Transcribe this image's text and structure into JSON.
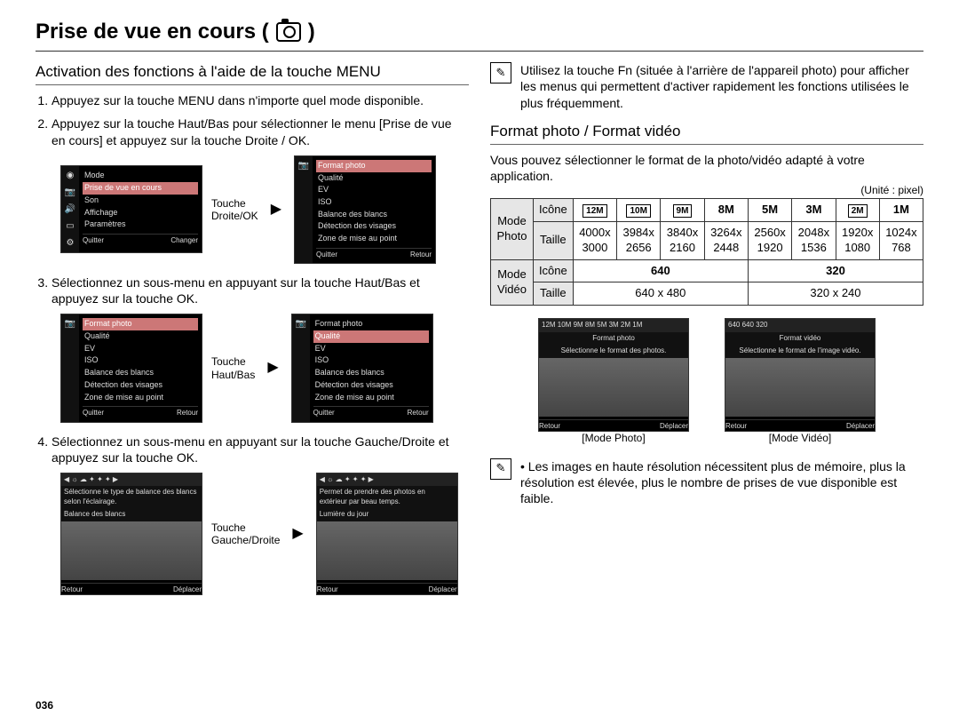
{
  "pageTitle": "Prise de vue en cours (",
  "pageTitleEnd": ")",
  "pageNumber": "036",
  "left": {
    "section": "Activation des fonctions à l'aide de la touche MENU",
    "steps": {
      "1": "Appuyez sur la touche MENU dans n'importe quel mode disponible.",
      "2": "Appuyez sur la touche Haut/Bas pour sélectionner le menu [Prise de vue en cours] et appuyez sur la touche Droite / OK.",
      "3": "Sélectionnez un sous-menu en appuyant sur la touche Haut/Bas et appuyez sur la touche OK.",
      "4": "Sélectionnez un sous-menu en appuyant sur la touche Gauche/Droite et appuyez sur la touche OK."
    },
    "fig1Label": "Touche\nDroite/OK",
    "fig2Label": "Touche\nHaut/Bas",
    "fig3Label": "Touche\nGauche/Droite"
  },
  "right": {
    "note1": "Utilisez la touche Fn (située à l'arrière de l'appareil photo) pour afficher les menus qui permettent d'activer rapidement les fonctions utilisées le plus fréquemment.",
    "section": "Format photo / Format vidéo",
    "intro": "Vous pouvez sélectionner le format de la photo/vidéo adapté à votre application.",
    "unit": "(Unité : pixel) ",
    "note2": "Les images en haute résolution nécessitent plus de mémoire, plus la résolution est élevée, plus le nombre de prises de vue disponible est faible.",
    "modePhotoCap": "[Mode Photo]",
    "modeVideoCap": "[Mode Vidéo]"
  },
  "table": {
    "photoHeader": "Mode Photo",
    "videoHeader": "Mode Vidéo",
    "rowIcon": "Icône",
    "rowSize": "Taille",
    "photoIcons": [
      "12M",
      "10M",
      "9M",
      "8M",
      "5M",
      "3M",
      "2M",
      "1M"
    ],
    "photoSizes": [
      "4000x 3000",
      "3984x 2656",
      "3840x 2160",
      "3264x 2448",
      "2560x 1920",
      "2048x 1536",
      "1920x 1080",
      "1024x 768"
    ],
    "videoIcons": [
      "640",
      "320"
    ],
    "videoSizes": [
      "640 x 480",
      "320 x 240"
    ]
  },
  "lcdMenu": {
    "items": [
      "Mode",
      "Prise de vue en cours",
      "Son",
      "Affichage",
      "Paramètres"
    ],
    "sub": [
      "Format photo",
      "Qualité",
      "EV",
      "ISO",
      "Balance des blancs",
      "Détection des visages",
      "Zone de mise au point"
    ],
    "subHighlight": "Qualité",
    "footerLeft": "Quitter",
    "footerRight1": "Changer",
    "footerRight2": "Retour"
  },
  "lcdPhoto": {
    "line1": "Balance des blancs",
    "line2a": "Sélectionne le type de balance des blancs selon l'éclairage.",
    "line2b": "Permet de prendre des photos en extérieur par beau temps.",
    "line2c": "Lumière du jour",
    "modeIcons": "12M 10M 9M 8M 5M 3M 2M 1M",
    "modeLine2": "Format photo",
    "modeLine3": "Sélectionne le format des photos.",
    "videoIcons": "640 640 320",
    "videoLine2": "Format vidéo",
    "videoLine3": "Sélectionne le format de l'image vidéo.",
    "btnRetour": "Retour",
    "btnDeplacer": "Déplacer"
  }
}
